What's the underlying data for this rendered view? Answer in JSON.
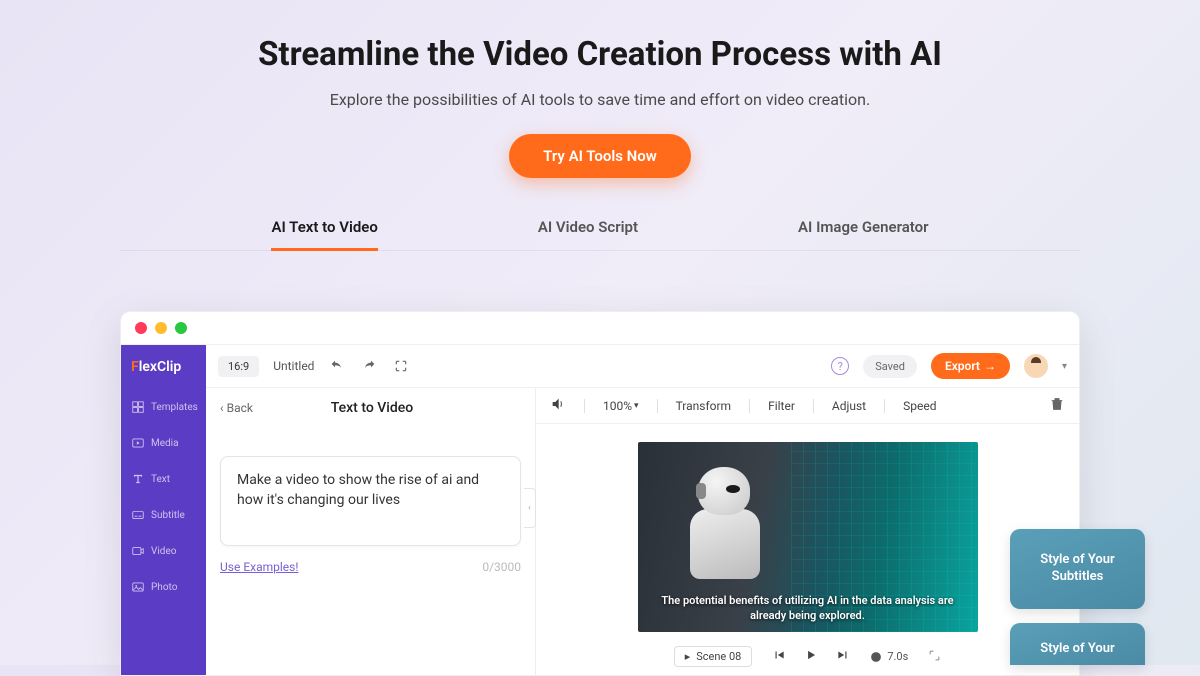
{
  "hero": {
    "title": "Streamline the Video Creation Process with AI",
    "subtitle": "Explore the possibilities of AI tools to save time and effort on video creation.",
    "cta": "Try AI Tools Now"
  },
  "tabs": [
    {
      "label": "AI Text to Video",
      "active": true
    },
    {
      "label": "AI Video Script",
      "active": false
    },
    {
      "label": "AI Image Generator",
      "active": false
    }
  ],
  "app": {
    "logo_prefix": "F",
    "logo_rest": "lexClip",
    "sidebar": [
      {
        "label": "Templates"
      },
      {
        "label": "Media"
      },
      {
        "label": "Text"
      },
      {
        "label": "Subtitle"
      },
      {
        "label": "Video"
      },
      {
        "label": "Photo"
      }
    ],
    "topbar": {
      "ratio": "16:9",
      "doc_title": "Untitled",
      "saved": "Saved",
      "export": "Export"
    },
    "panel": {
      "back": "Back",
      "title": "Text to Video",
      "prompt": "Make a video to show the rise of ai and how it's changing our lives",
      "examples_link": "Use Examples!",
      "char_count": "0/3000"
    },
    "controls": {
      "zoom": "100%",
      "items": [
        "Transform",
        "Filter",
        "Adjust",
        "Speed"
      ]
    },
    "preview": {
      "caption": "The potential benefits of utilizing AI in the data analysis are already being explored.",
      "scene": "Scene 08",
      "duration": "7.0s"
    }
  },
  "side_cards": [
    "Style of Your Subtitles",
    "Style of Your"
  ]
}
